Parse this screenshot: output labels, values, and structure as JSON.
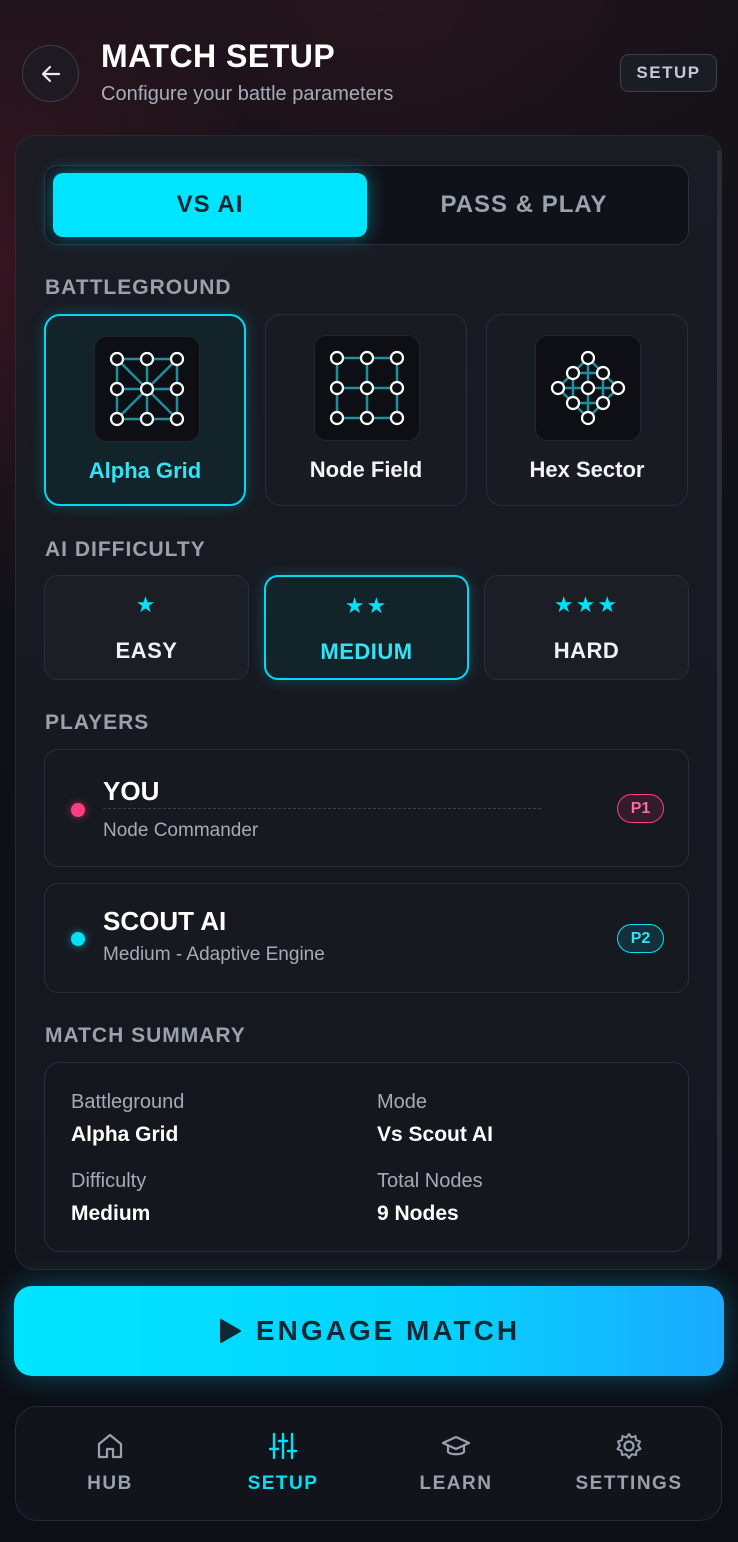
{
  "header": {
    "title": "MATCH SETUP",
    "subtitle": "Configure your battle parameters",
    "badge": "SETUP"
  },
  "mode": {
    "options": [
      "VS AI",
      "PASS & PLAY"
    ],
    "selected": "VS AI"
  },
  "battleground": {
    "label": "BATTLEGROUND",
    "options": [
      {
        "name": "Alpha Grid",
        "icon": "alpha-grid-icon"
      },
      {
        "name": "Node Field",
        "icon": "node-field-icon"
      },
      {
        "name": "Hex Sector",
        "icon": "hex-sector-icon"
      }
    ],
    "selected": "Alpha Grid"
  },
  "difficulty": {
    "label": "AI DIFFICULTY",
    "options": [
      {
        "name": "EASY",
        "stars": "★"
      },
      {
        "name": "MEDIUM",
        "stars": "★★"
      },
      {
        "name": "HARD",
        "stars": "★★★"
      }
    ],
    "selected": "MEDIUM"
  },
  "players": {
    "label": "PLAYERS",
    "list": [
      {
        "name": "YOU",
        "subtitle": "Node Commander",
        "badge": "P1",
        "color": "#ff3d7f"
      },
      {
        "name": "SCOUT AI",
        "subtitle": "Medium - Adaptive Engine",
        "badge": "P2",
        "color": "#00e1f5"
      }
    ]
  },
  "summary": {
    "label": "MATCH SUMMARY",
    "battleground_key": "Battleground",
    "battleground_val": "Alpha Grid",
    "mode_key": "Mode",
    "mode_val": "Vs Scout AI",
    "difficulty_key": "Difficulty",
    "difficulty_val": "Medium",
    "nodes_key": "Total Nodes",
    "nodes_val": "9 Nodes"
  },
  "engage": {
    "label": "ENGAGE MATCH",
    "icon": "play-icon"
  },
  "nav": {
    "items": [
      {
        "label": "HUB",
        "icon": "home-icon"
      },
      {
        "label": "SETUP",
        "icon": "sliders-icon"
      },
      {
        "label": "LEARN",
        "icon": "graduation-cap-icon"
      },
      {
        "label": "SETTINGS",
        "icon": "gear-icon"
      }
    ],
    "active": "SETUP"
  },
  "colors": {
    "accent": "#00e5ff",
    "p1": "#ff3d7f",
    "p2": "#00e1f5"
  }
}
